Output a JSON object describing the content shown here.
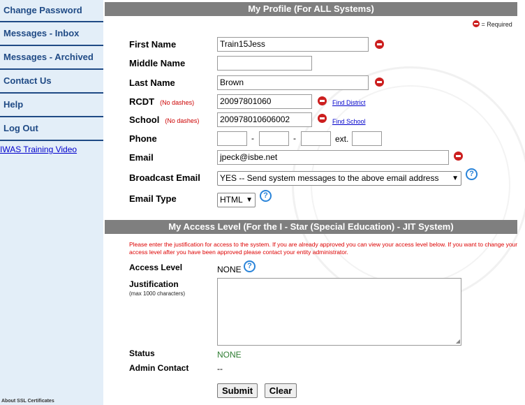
{
  "sidebar": {
    "items": [
      {
        "label": "Change Password"
      },
      {
        "label": "Messages - Inbox"
      },
      {
        "label": "Messages - Archived"
      },
      {
        "label": "Contact Us"
      },
      {
        "label": "Help"
      },
      {
        "label": "Log Out"
      }
    ],
    "video_link": "IWAS Training Video",
    "ssl_note": "About SSL Certificates"
  },
  "profile": {
    "header": "My Profile (For ALL Systems)",
    "required_legend": "= Required",
    "first_name_label": "First Name",
    "first_name_value": "Train15Jess",
    "middle_name_label": "Middle Name",
    "middle_name_value": "",
    "last_name_label": "Last Name",
    "last_name_value": "Brown",
    "rcdt_label": "RCDT",
    "rcdt_note": "(No dashes)",
    "rcdt_value": "20097801060",
    "find_district": "Find District",
    "school_label": "School",
    "school_note": "(No dashes)",
    "school_value": "200978010606002",
    "find_school": "Find School",
    "phone_label": "Phone",
    "phone_dash": "-",
    "phone_ext": "ext.",
    "phone_area": "",
    "phone_prefix": "",
    "phone_line": "",
    "phone_extension": "",
    "email_label": "Email",
    "email_value": "jpeck@isbe.net",
    "broadcast_label": "Broadcast Email",
    "broadcast_value": "YES -- Send system messages to the above email address",
    "email_type_label": "Email Type",
    "email_type_value": "HTML"
  },
  "access": {
    "header": "My Access Level (For the I - Star (Special Education) - JIT System)",
    "instructions": "Please enter the justification for access to the system. If you are already approved you can view your access level below. If you want to change your access level after you have been approved please contact your entity administrator.",
    "access_level_label": "Access Level",
    "access_level_value": "NONE",
    "justification_label": "Justification",
    "justification_note": "(max 1000 characters)",
    "status_label": "Status",
    "status_value": "NONE",
    "admin_contact_label": "Admin Contact",
    "admin_contact_value": "--",
    "submit_label": "Submit",
    "clear_label": "Clear"
  },
  "colors": {
    "sidebar_bg": "#e3eef8",
    "nav_text": "#1f4a85",
    "header_bg": "#7f7f7f",
    "required_red": "#cc1f1f",
    "status_green": "#2e7d32",
    "help_blue": "#2a84d9"
  }
}
